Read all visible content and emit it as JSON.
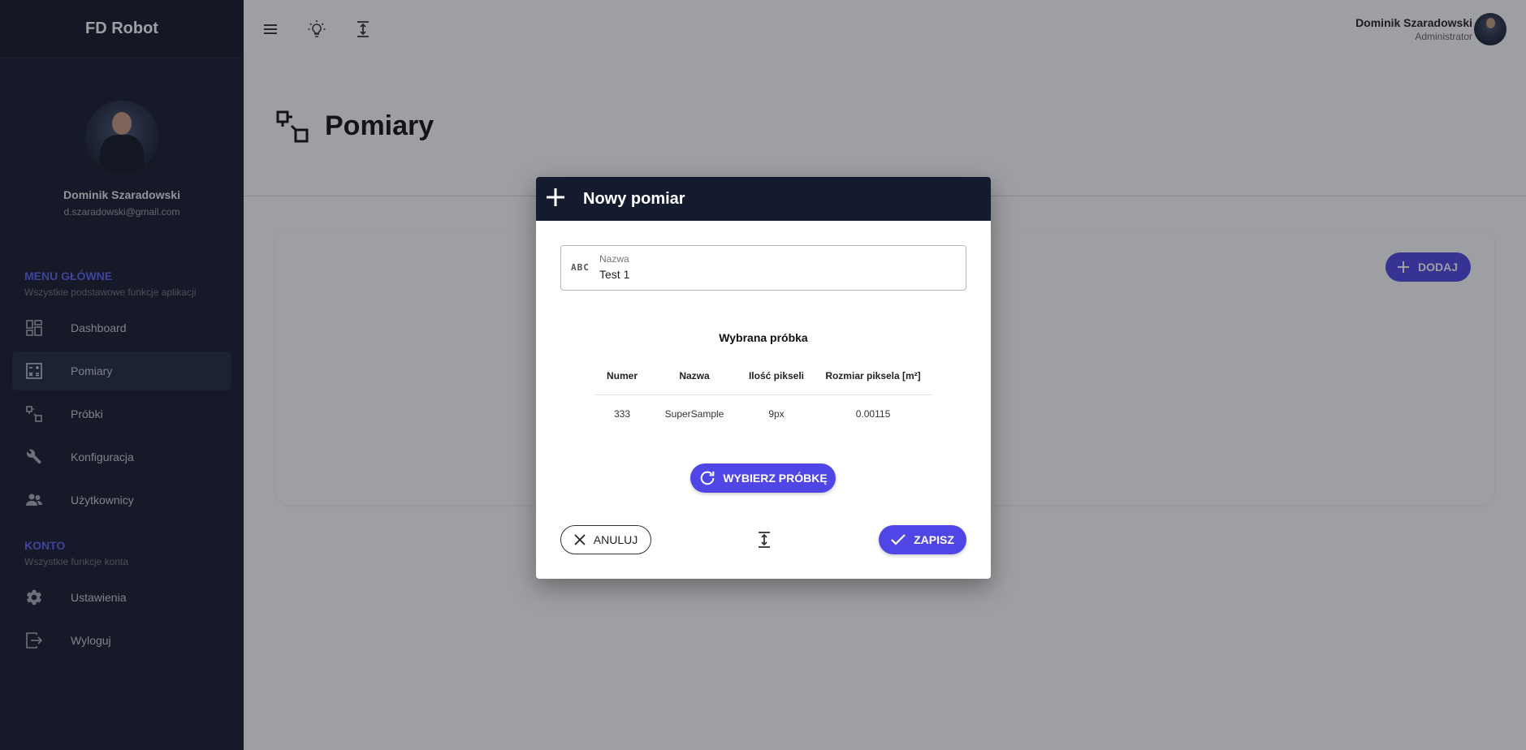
{
  "app": {
    "brand": "FD Robot"
  },
  "profile": {
    "name": "Dominik Szaradowski",
    "email": "d.szaradowski@gmail.com"
  },
  "sidebar": {
    "main_title": "MENU GŁÓWNE",
    "main_subtitle": "Wszystkie podstawowe funkcje aplikacji",
    "main_items": [
      {
        "label": "Dashboard",
        "icon": "dashboard-icon"
      },
      {
        "label": "Pomiary",
        "icon": "calculator-icon",
        "active": true
      },
      {
        "label": "Próbki",
        "icon": "squares-icon"
      },
      {
        "label": "Konfiguracja",
        "icon": "wrench-icon"
      },
      {
        "label": "Użytkownicy",
        "icon": "users-icon"
      }
    ],
    "account_title": "KONTO",
    "account_subtitle": "Wszystkie funkcje konta",
    "account_items": [
      {
        "label": "Ustawienia",
        "icon": "gear-icon"
      },
      {
        "label": "Wyloguj",
        "icon": "logout-icon"
      }
    ]
  },
  "topbar": {
    "icons": [
      "menu-icon",
      "lightbulb-icon",
      "vertical-align-icon"
    ],
    "user_name": "Dominik Szaradowski",
    "user_role": "Administrator"
  },
  "page": {
    "title": "Pomiary",
    "icon": "squares-icon",
    "add_label": "DODAJ"
  },
  "dialog": {
    "title": "Nowy pomiar",
    "field": {
      "icon_text": "ABC",
      "label": "Nazwa",
      "value": "Test 1"
    },
    "sample_title": "Wybrana próbka",
    "table": {
      "headers": [
        "Numer",
        "Nazwa",
        "Ilość pikseli",
        "Rozmiar piksela [m²]"
      ],
      "rows": [
        [
          "333",
          "SuperSample",
          "9px",
          "0.00115"
        ]
      ]
    },
    "pick_label": "WYBIERZ PRÓBKĘ",
    "cancel_label": "ANULUJ",
    "save_label": "ZAPISZ"
  },
  "colors": {
    "sidebar_bg": "#151b2e",
    "accent": "#4f46e5",
    "section_title": "#5e63f0"
  }
}
